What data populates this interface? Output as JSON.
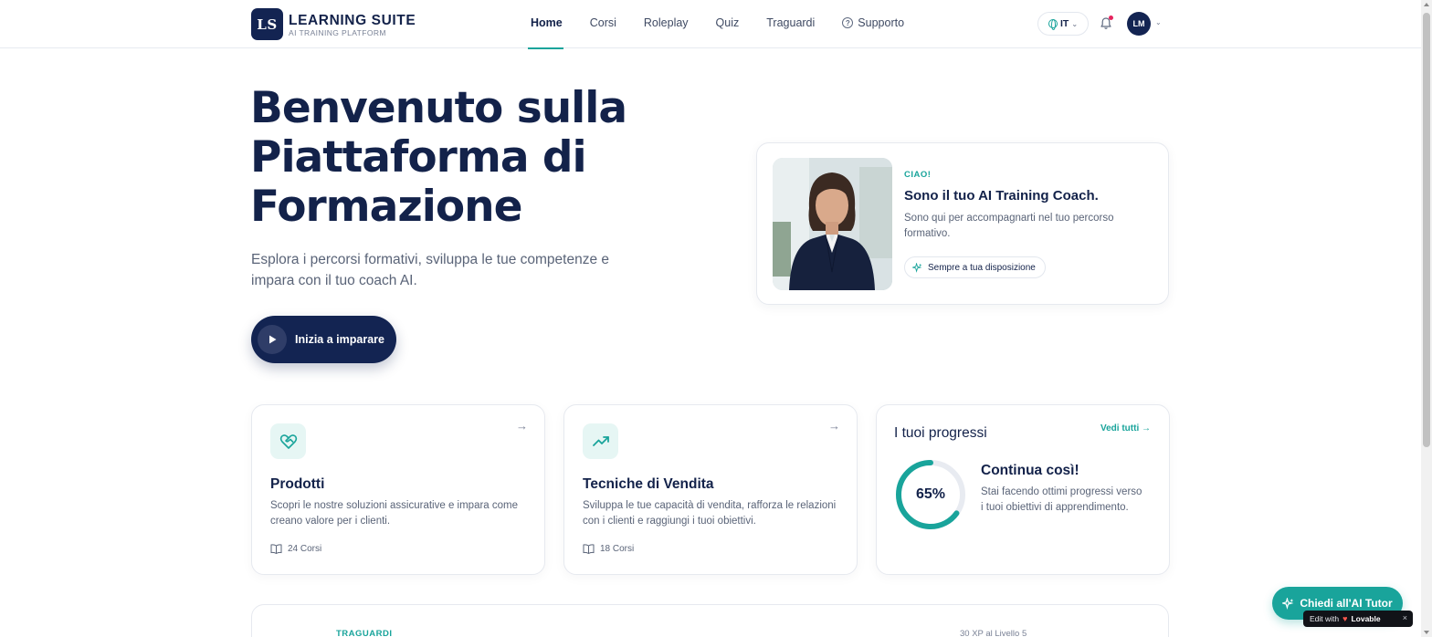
{
  "header": {
    "logo_text": "LS",
    "brand_title": "LEARNING SUITE",
    "brand_subtitle": "AI TRAINING PLATFORM",
    "nav": [
      {
        "label": "Home",
        "active": true
      },
      {
        "label": "Corsi"
      },
      {
        "label": "Roleplay"
      },
      {
        "label": "Quiz"
      },
      {
        "label": "Traguardi"
      },
      {
        "label": "Supporto",
        "icon": "help-circle-icon"
      }
    ],
    "language": "IT",
    "avatar_initials": "LM",
    "notification_dot_color": "#e5245e"
  },
  "hero": {
    "title": "Benvenuto sulla Piattaforma di Formazione",
    "subtitle": "Esplora i percorsi formativi, sviluppa le tue competenze e impara con il tuo coach AI.",
    "cta_label": "Inizia a imparare"
  },
  "coach": {
    "eyebrow": "CIAO!",
    "title": "Sono il tuo AI Training Coach.",
    "text": "Sono qui per accompagnarti nel tuo percorso formativo.",
    "pill_label": "Sempre a tua disposizione"
  },
  "cards": [
    {
      "title": "Prodotti",
      "text": "Scopri le nostre soluzioni assicurative e impara come creano valore per i clienti.",
      "meta": "24 Corsi",
      "icon": "heart-handshake-icon"
    },
    {
      "title": "Tecniche di Vendita",
      "text": "Sviluppa le tue capacità di vendita, rafforza le relazioni con i clienti e raggiungi i tuoi obiettivi.",
      "meta": "18 Corsi",
      "icon": "trending-up-icon"
    }
  ],
  "progress": {
    "title": "I tuoi progressi",
    "link": "Vedi tutti →",
    "percent_label": "65%",
    "percent": 65,
    "headline": "Continua così!",
    "text": "Stai facendo ottimi progressi verso i tuoi obiettivi di apprendimento."
  },
  "bottom": {
    "eyebrow": "TRAGUARDI",
    "xp_text": "30 XP al Livello 5"
  },
  "tutor_button": "Chiedi all'AI Tutor",
  "lovable_badge": {
    "prefix": "Edit with",
    "brand": "Lovable",
    "close": "×"
  },
  "colors": {
    "primary": "#132452",
    "accent": "#19a49b"
  }
}
